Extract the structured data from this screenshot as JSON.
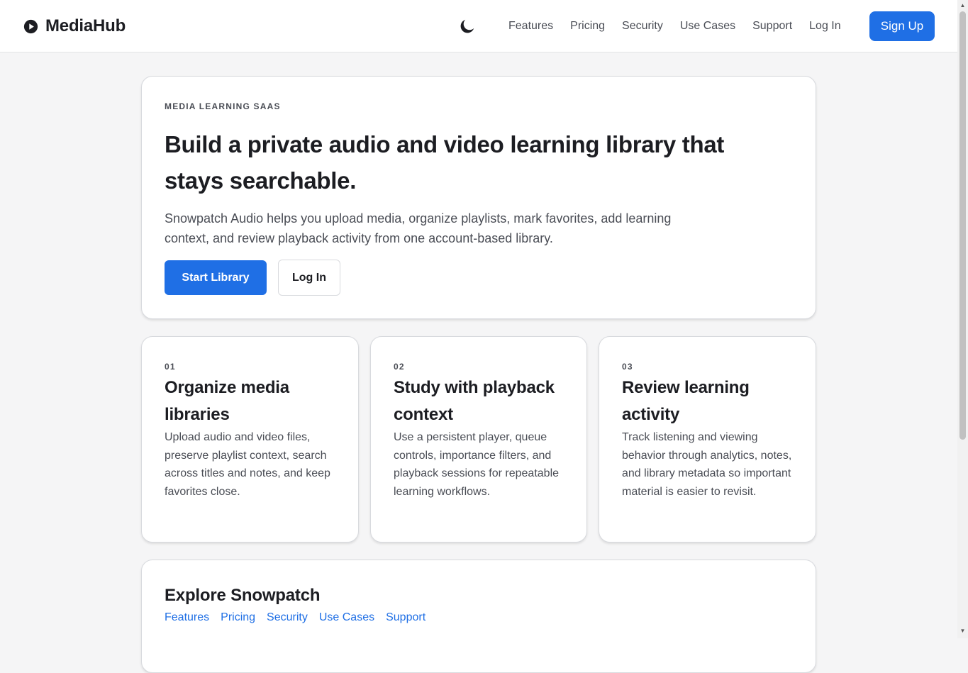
{
  "header": {
    "brand": "MediaHub",
    "nav": [
      "Features",
      "Pricing",
      "Security",
      "Use Cases",
      "Support",
      "Log In"
    ],
    "signup_label": "Sign Up"
  },
  "hero": {
    "eyebrow": "MEDIA LEARNING SAAS",
    "title": "Build a private audio and video learning library that stays searchable.",
    "text": "Snowpatch Audio helps you upload media, organize playlists, mark favorites, add learning context, and review playback activity from one account-based library.",
    "primary_label": "Start Library",
    "secondary_label": "Log In"
  },
  "features": [
    {
      "num": "01",
      "title": "Organize media libraries",
      "text": "Upload audio and video files, preserve playlist context, search across titles and notes, and keep favorites close."
    },
    {
      "num": "02",
      "title": "Study with playback context",
      "text": "Use a persistent player, queue controls, importance filters, and playback sessions for repeatable learning workflows."
    },
    {
      "num": "03",
      "title": "Review learning activity",
      "text": "Track listening and viewing behavior through analytics, notes, and library metadata so important material is easier to revisit."
    }
  ],
  "explore": {
    "title": "Explore Snowpatch",
    "links": [
      "Features",
      "Pricing",
      "Security",
      "Use Cases",
      "Support"
    ]
  },
  "colors": {
    "accent": "#1f6fe5",
    "text": "#1c1d22",
    "muted": "#4a4d55",
    "background": "#f5f5f6"
  },
  "icons": {
    "brand": "play-circle-icon",
    "theme": "moon-icon"
  }
}
